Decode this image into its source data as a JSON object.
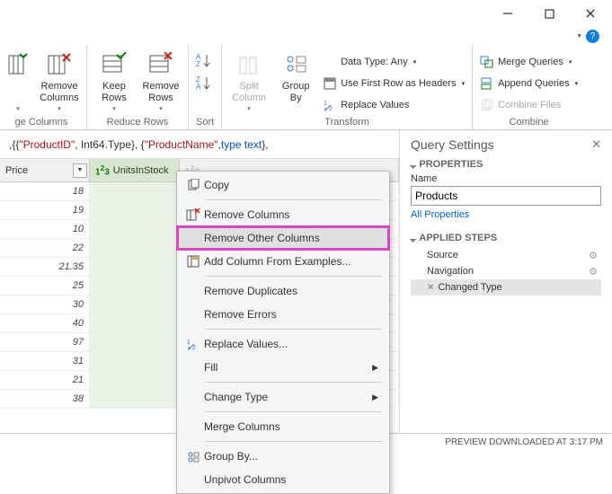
{
  "ribbon": {
    "group1": {
      "btn1": "Remove\nColumns",
      "label": "ge Columns"
    },
    "group2": {
      "btn1": "Keep\nRows",
      "btn2": "Remove\nRows",
      "label": "Reduce Rows"
    },
    "group3": {
      "label": "Sort"
    },
    "group4": {
      "btn1": "Split\nColumn",
      "btn2": "Group\nBy",
      "row1": "Data Type: Any",
      "row2": "Use First Row as Headers",
      "row3": "Replace Values",
      "label": "Transform"
    },
    "group5": {
      "row1": "Merge Queries",
      "row2": "Append Queries",
      "row3": "Combine Files",
      "label": "Combine"
    }
  },
  "formula": {
    "p1": ",{{",
    "s1": "\"ProductID\"",
    "p2": ", Int64.Type}, {",
    "s2": "\"ProductName\"",
    "p3": ", ",
    "kw": "type text",
    "p4": "},"
  },
  "headers": {
    "c1": "Price",
    "c2": "UnitsInStock",
    "c3": ""
  },
  "rows": [
    [
      "18",
      ""
    ],
    [
      "19",
      ""
    ],
    [
      "10",
      ""
    ],
    [
      "22",
      ""
    ],
    [
      "21.35",
      ""
    ],
    [
      "25",
      ""
    ],
    [
      "30",
      ""
    ],
    [
      "40",
      ""
    ],
    [
      "97",
      ""
    ],
    [
      "31",
      ""
    ],
    [
      "21",
      ""
    ],
    [
      "38",
      ""
    ]
  ],
  "ctx": {
    "copy": "Copy",
    "remove": "Remove Columns",
    "removeOther": "Remove Other Columns",
    "addExample": "Add Column From Examples...",
    "dup": "Remove Duplicates",
    "err": "Remove Errors",
    "replace": "Replace Values...",
    "fill": "Fill",
    "changeType": "Change Type",
    "merge": "Merge Columns",
    "groupBy": "Group By...",
    "unpivot": "Unpivot Columns"
  },
  "qs": {
    "title": "Query Settings",
    "props": "PROPERTIES",
    "nameLbl": "Name",
    "nameVal": "Products",
    "allProps": "All Properties",
    "applied": "APPLIED STEPS",
    "steps": [
      "Source",
      "Navigation",
      "Changed Type"
    ]
  },
  "footer": "PREVIEW DOWNLOADED AT 3:17 PM"
}
